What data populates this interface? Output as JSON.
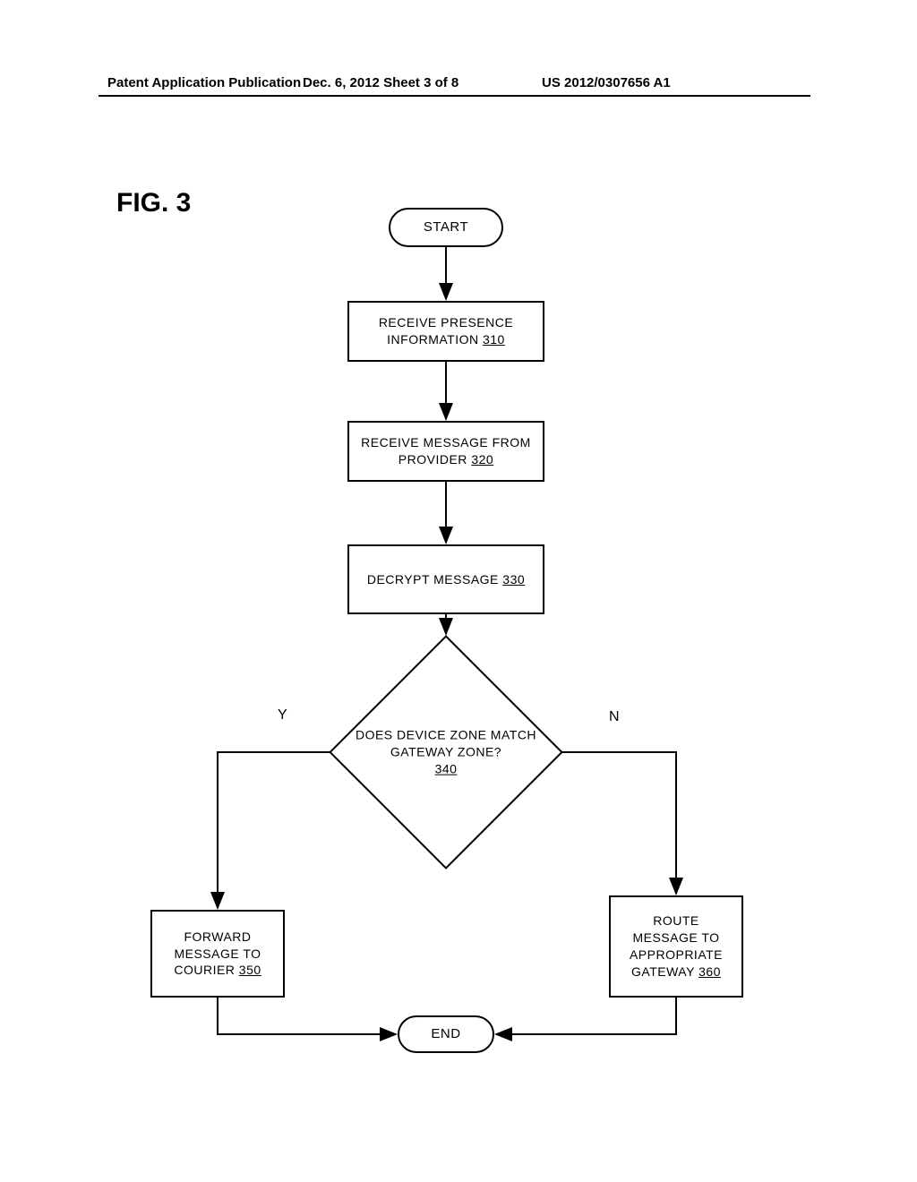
{
  "header": {
    "left": "Patent Application Publication",
    "center": "Dec. 6, 2012  Sheet 3 of 8",
    "right": "US 2012/0307656 A1"
  },
  "figure": {
    "label": "FIG. 3",
    "start": "START",
    "end": "END",
    "step310_line1": "RECEIVE PRESENCE",
    "step310_line2": "INFORMATION ",
    "step310_ref": "310",
    "step320_line1": "RECEIVE MESSAGE FROM",
    "step320_line2": "PROVIDER ",
    "step320_ref": "320",
    "step330_line1": "DECRYPT MESSAGE ",
    "step330_ref": "330",
    "decision_line1": "DOES DEVICE ZONE MATCH",
    "decision_line2": "GATEWAY ZONE?",
    "decision_ref": "340",
    "yes": "Y",
    "no": "N",
    "step350_line1": "FORWARD",
    "step350_line2": "MESSAGE TO",
    "step350_line3": "COURIER ",
    "step350_ref": "350",
    "step360_line1": "ROUTE",
    "step360_line2": "MESSAGE TO",
    "step360_line3": "APPROPRIATE",
    "step360_line4": "GATEWAY ",
    "step360_ref": "360"
  }
}
